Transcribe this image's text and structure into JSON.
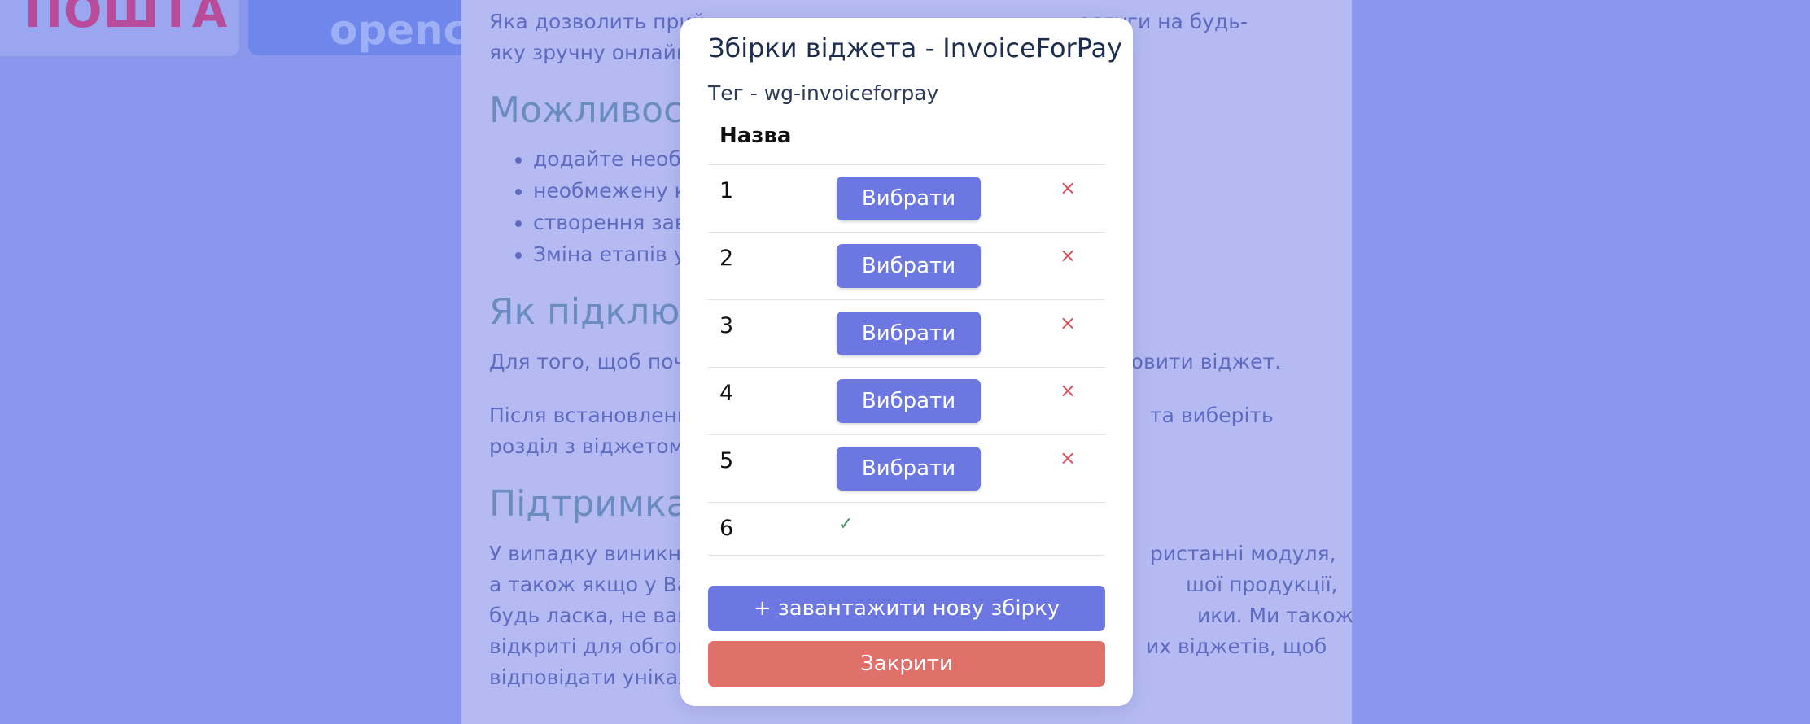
{
  "background": {
    "logo_text": "ПОШТА",
    "opencart_text": "openc",
    "paragraph_intro_line1": "Яка дозволить прий",
    "paragraph_intro_line1_end": "ослуги на будь-",
    "paragraph_intro_line2": "яку зручну онлайн",
    "heading_features": "Можливос",
    "features": [
      "додайте необ",
      "необмежену к",
      "створення зав",
      "Зміна етапів у"
    ],
    "heading_connect": "Як підключ",
    "connect_line1": "Для того, щоб поч",
    "connect_line1_end": "ановити віджет.",
    "after_install_line1": "Після встановленн",
    "after_install_line1_end": "та виберіть",
    "after_install_line2": "розділ з віджетом",
    "heading_support": "Підтримка",
    "support_line1": "У випадку виникн",
    "support_line1_end": "ристанні модуля,",
    "support_line2": "а також якщо у Ва",
    "support_line2_end": "шої продукції,",
    "support_line3": "будь ласка, не ваг",
    "support_line3_end": "ики. Ми також",
    "support_line4": "відкриті для обгов",
    "support_line4_end": "их віджетів, щоб",
    "support_line5": "відповідати унікал"
  },
  "modal": {
    "title": "Збірки віджета - InvoiceForPay",
    "tag_label": "Тег - wg-invoiceforpay",
    "column_name": "Назва",
    "rows": [
      {
        "name": "1",
        "select_label": "Вибрати",
        "delete_icon": "×"
      },
      {
        "name": "2",
        "select_label": "Вибрати",
        "delete_icon": "×"
      },
      {
        "name": "3",
        "select_label": "Вибрати",
        "delete_icon": "×"
      },
      {
        "name": "4",
        "select_label": "Вибрати",
        "delete_icon": "×"
      },
      {
        "name": "5",
        "select_label": "Вибрати",
        "delete_icon": "×"
      },
      {
        "name": "6",
        "selected_icon": "✓"
      }
    ],
    "add_button_label": "+ завантажити нову збірку",
    "close_button_label": "Закрити"
  }
}
